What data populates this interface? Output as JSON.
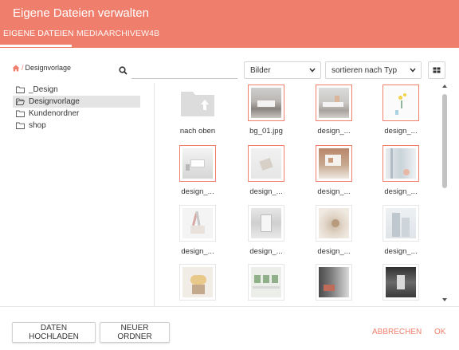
{
  "header": {
    "title": "Eigene Dateien verwalten",
    "tabs": [
      {
        "label": "EIGENE DATEIEN",
        "active": true
      },
      {
        "label": "MEDIAARCHIVEW4B",
        "active": false
      }
    ]
  },
  "breadcrumb": {
    "label": "Designvorlage"
  },
  "search": {
    "placeholder": "",
    "value": ""
  },
  "tree": [
    {
      "label": "_Design",
      "icon": "folder-icon",
      "selected": false
    },
    {
      "label": "Designvorlage",
      "icon": "folder-open-icon",
      "selected": true
    },
    {
      "label": "Kundenordner",
      "icon": "folder-icon",
      "selected": false
    },
    {
      "label": "shop",
      "icon": "folder-icon",
      "selected": false
    }
  ],
  "filters": {
    "type_select": "Bilder",
    "sort_select": "sortieren nach Typ"
  },
  "files": [
    {
      "label": "nach oben",
      "kind": "up-folder"
    },
    {
      "label": "bg_01.jpg",
      "kind": "image",
      "selected": true
    },
    {
      "label": "design_...",
      "kind": "image",
      "selected": true
    },
    {
      "label": "design_...",
      "kind": "image",
      "selected": true
    },
    {
      "label": "design_...",
      "kind": "image",
      "selected": true
    },
    {
      "label": "design_...",
      "kind": "image",
      "selected": true
    },
    {
      "label": "design_...",
      "kind": "image",
      "selected": true
    },
    {
      "label": "design_...",
      "kind": "image",
      "selected": true
    },
    {
      "label": "design_...",
      "kind": "image",
      "selected": false
    },
    {
      "label": "design_...",
      "kind": "image",
      "selected": false
    },
    {
      "label": "design_...",
      "kind": "image",
      "selected": false
    },
    {
      "label": "design_...",
      "kind": "image",
      "selected": false
    },
    {
      "label": "",
      "kind": "image",
      "selected": false
    },
    {
      "label": "",
      "kind": "image",
      "selected": false
    },
    {
      "label": "",
      "kind": "image",
      "selected": false
    },
    {
      "label": "",
      "kind": "image",
      "selected": false
    }
  ],
  "footer": {
    "upload_label": "DATEN HOCHLADEN",
    "new_folder_label": "NEUER ORDNER",
    "cancel_label": "ABBRECHEN",
    "ok_label": "OK"
  },
  "colors": {
    "accent": "#ef7f6c",
    "selected_row": "#e4e4e4"
  }
}
